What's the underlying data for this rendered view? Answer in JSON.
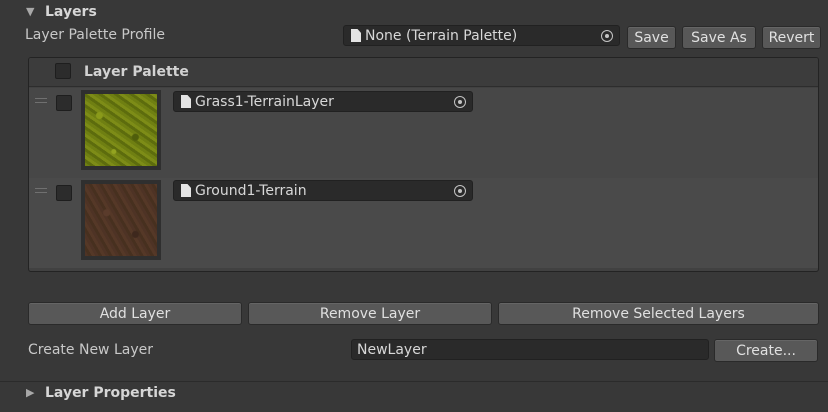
{
  "layers_section": {
    "title": "Layers",
    "profile_label": "Layer Palette Profile",
    "profile_value": "None (Terrain Palette)",
    "save_label": "Save",
    "save_as_label": "Save As",
    "revert_label": "Revert"
  },
  "palette": {
    "header": "Layer Palette",
    "layers": [
      {
        "name": "Grass1-TerrainLayer",
        "texture": "grass-texture",
        "selected": false
      },
      {
        "name": "Ground1-Terrain",
        "texture": "ground-texture",
        "selected": false
      }
    ]
  },
  "actions": {
    "add_layer": "Add Layer",
    "remove_layer": "Remove Layer",
    "remove_selected": "Remove Selected Layers"
  },
  "create": {
    "label": "Create New Layer",
    "input_value": "NewLayer",
    "button": "Create..."
  },
  "properties_section": {
    "title": "Layer Properties"
  },
  "icons": {
    "expanded": "triangle-down-icon",
    "collapsed": "triangle-right-icon",
    "asset": "document-icon",
    "picker": "object-picker-icon"
  }
}
